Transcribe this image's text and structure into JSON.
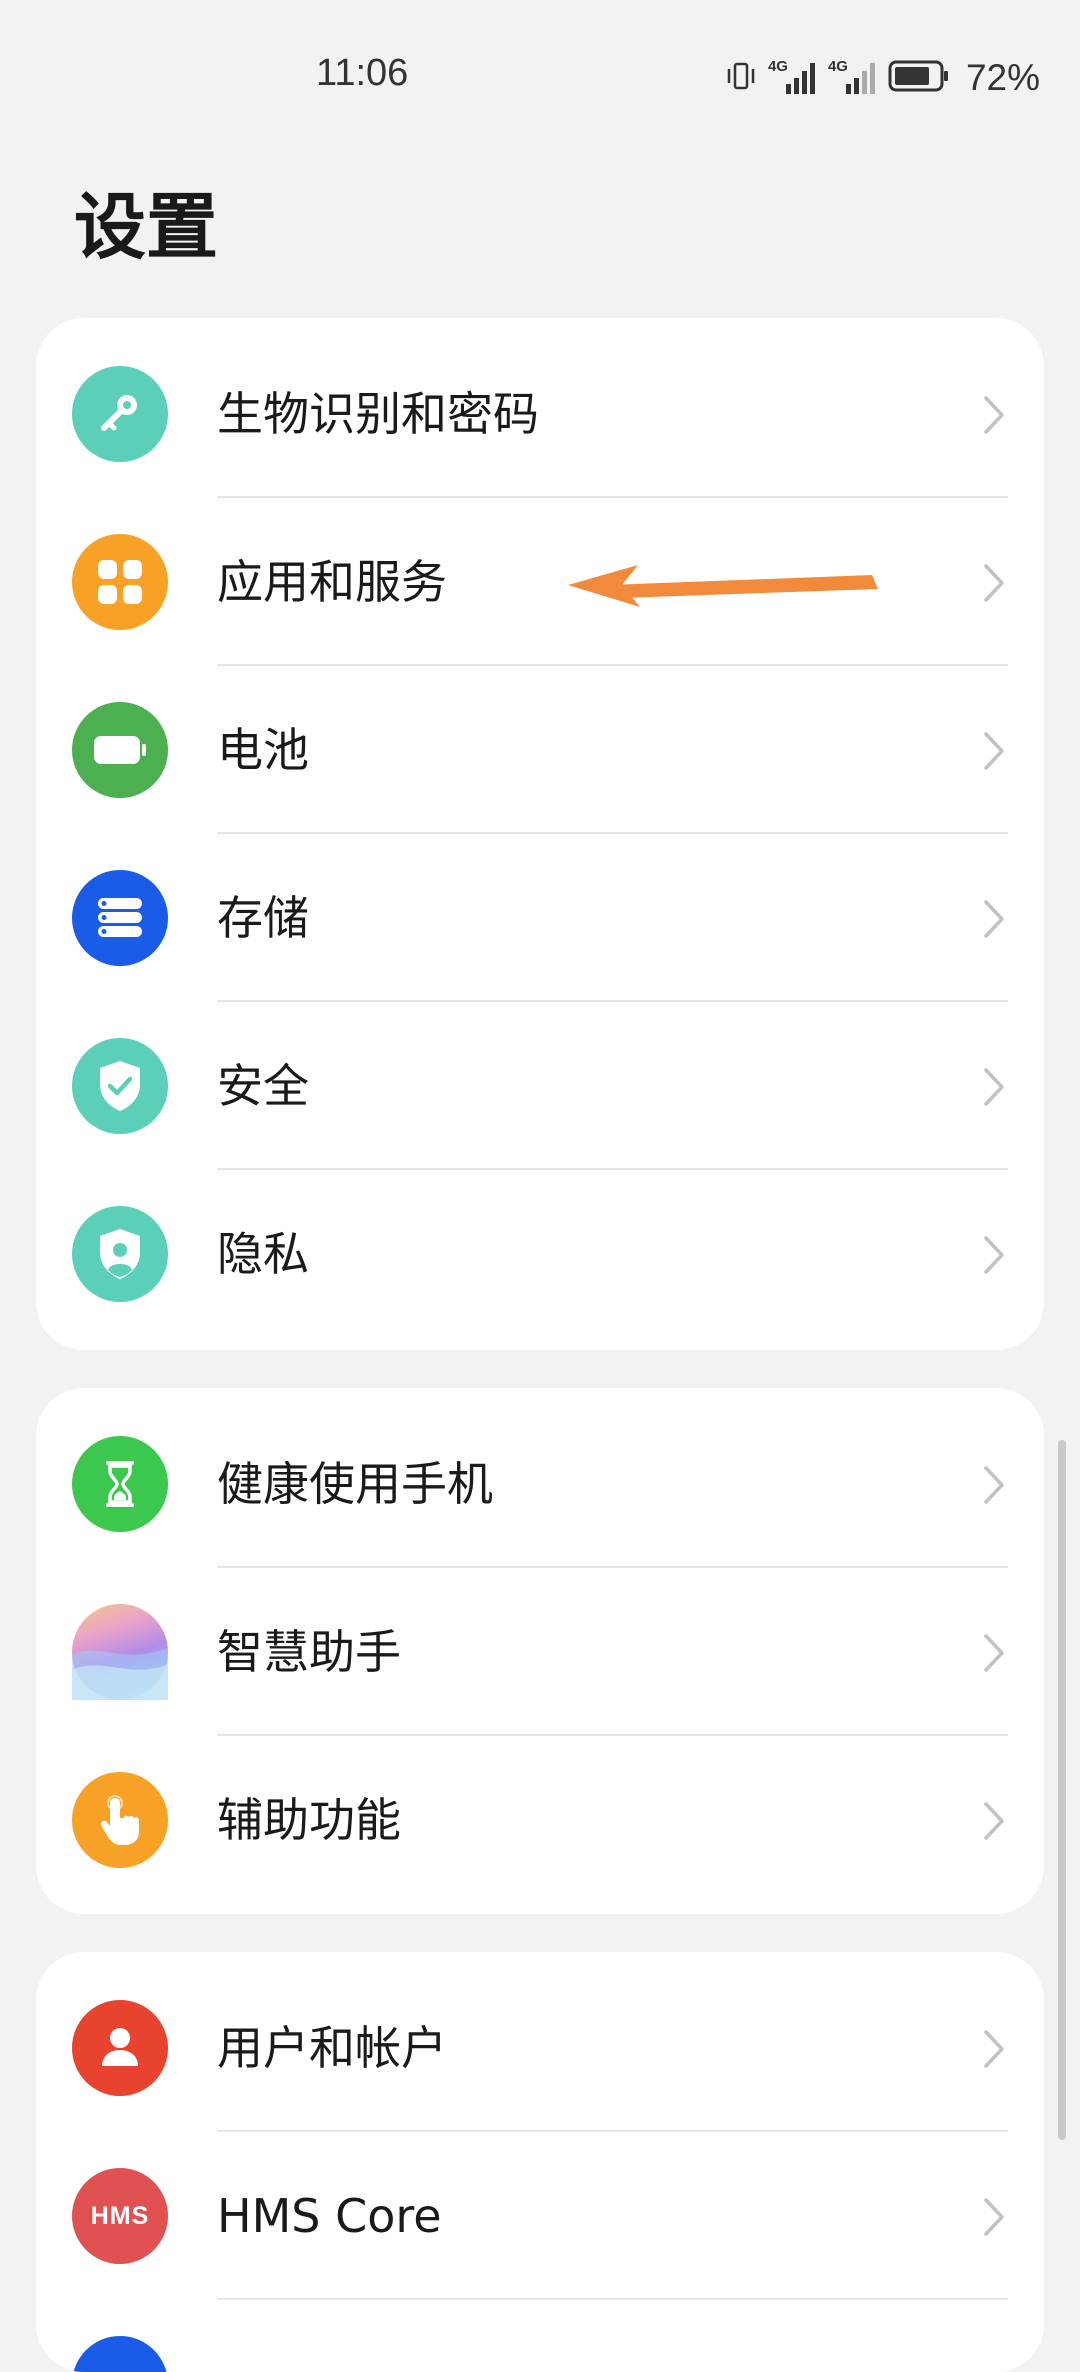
{
  "status_bar": {
    "time": "11:06",
    "signal_1": "4G",
    "signal_2": "4G",
    "battery": "72%"
  },
  "page": {
    "title": "设置"
  },
  "groups": [
    {
      "items": [
        {
          "label": "生物识别和密码",
          "icon": "key-icon",
          "color": "#5ccfb8"
        },
        {
          "label": "应用和服务",
          "icon": "apps-grid-icon",
          "color": "#f7a227"
        },
        {
          "label": "电池",
          "icon": "battery-icon",
          "color": "#4caf50"
        },
        {
          "label": "存储",
          "icon": "storage-icon",
          "color": "#1a5be8"
        },
        {
          "label": "安全",
          "icon": "shield-check-icon",
          "color": "#5ccfb8"
        },
        {
          "label": "隐私",
          "icon": "privacy-shield-icon",
          "color": "#5ccfb8"
        }
      ]
    },
    {
      "items": [
        {
          "label": "健康使用手机",
          "icon": "hourglass-icon",
          "color": "#3cc84e"
        },
        {
          "label": "智慧助手",
          "icon": "assistant-orb-icon",
          "color": "#c9a6e8"
        },
        {
          "label": "辅助功能",
          "icon": "hand-pointer-icon",
          "color": "#f7a227"
        }
      ]
    },
    {
      "items": [
        {
          "label": "用户和帐户",
          "icon": "user-icon",
          "color": "#e8432f"
        },
        {
          "label": "HMS Core",
          "icon": "hms-icon",
          "color": "#e05252",
          "icon_text": "HMS"
        }
      ]
    }
  ],
  "annotation": {
    "color": "#f28a3c"
  }
}
